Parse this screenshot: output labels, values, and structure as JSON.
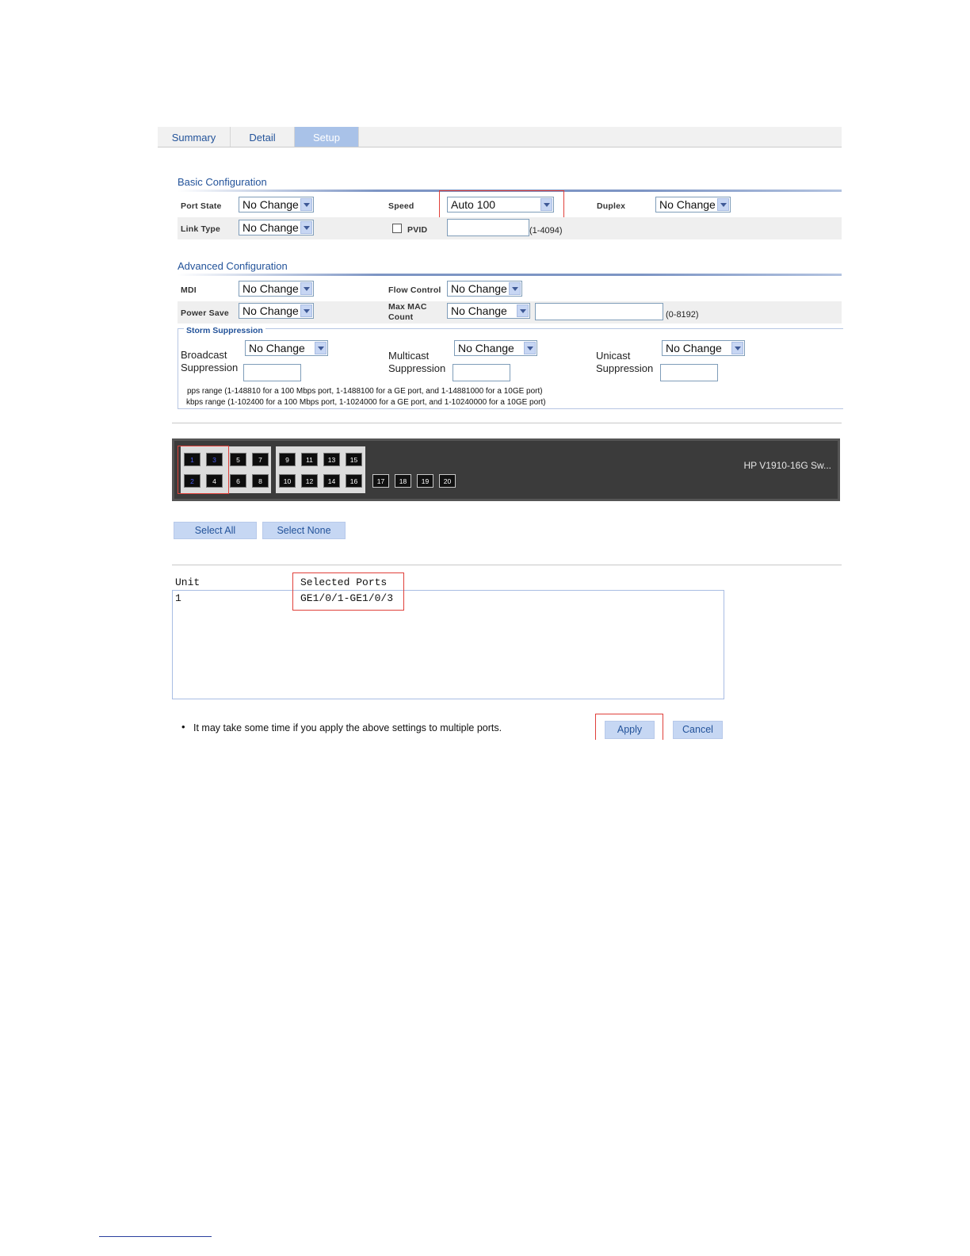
{
  "tabs": [
    {
      "label": "Summary"
    },
    {
      "label": "Detail"
    },
    {
      "label": "Setup"
    }
  ],
  "basic": {
    "title": "Basic Configuration",
    "port_state_label": "Port State",
    "port_state_value": "No Change",
    "speed_label": "Speed",
    "speed_value": "Auto 100",
    "duplex_label": "Duplex",
    "duplex_value": "No Change",
    "link_type_label": "Link Type",
    "link_type_value": "No Change",
    "pvid_label": "PVID",
    "pvid_value": "",
    "pvid_range": "(1-4094)"
  },
  "advanced": {
    "title": "Advanced Configuration",
    "mdi_label": "MDI",
    "mdi_value": "No Change",
    "flow_control_label": "Flow Control",
    "flow_control_value": "No Change",
    "power_save_label": "Power Save",
    "power_save_value": "No Change",
    "max_mac_label_1": "Max MAC",
    "max_mac_label_2": "Count",
    "max_mac_value": "No Change",
    "max_mac_range": "(0-8192)"
  },
  "storm": {
    "title": "Storm Suppression",
    "broadcast_label_1": "Broadcast",
    "broadcast_label_2": "Suppression",
    "broadcast_value": "No Change",
    "multicast_label_1": "Multicast",
    "multicast_label_2": "Suppression",
    "multicast_value": "No Change",
    "unicast_label_1": "Unicast",
    "unicast_label_2": "Suppression",
    "unicast_value": "No Change",
    "pps_note": "pps range (1-148810 for a 100 Mbps port, 1-1488100 for a GE port, and 1-14881000 for a 10GE port)",
    "kbps_note": "kbps range (1-102400 for a 100 Mbps port, 1-1024000 for a GE port, and 1-10240000 for a 10GE port)"
  },
  "device": {
    "name": "HP V1910-16G Sw...",
    "ports_top": [
      "1",
      "3",
      "5",
      "7",
      "9",
      "11",
      "13",
      "15"
    ],
    "ports_bottom": [
      "2",
      "4",
      "6",
      "8",
      "10",
      "12",
      "14",
      "16"
    ],
    "ports_sfp": [
      "17",
      "18",
      "19",
      "20"
    ],
    "selected_ports": [
      "1",
      "2",
      "3"
    ]
  },
  "select_all_label": "Select All",
  "select_none_label": "Select None",
  "table": {
    "col_unit": "Unit",
    "col_ports": "Selected Ports",
    "rows": [
      {
        "unit": "1",
        "ports": "GE1/0/1-GE1/0/3"
      }
    ]
  },
  "note": "It may take some time if you apply the above settings to multiple ports.",
  "apply_label": "Apply",
  "cancel_label": "Cancel"
}
